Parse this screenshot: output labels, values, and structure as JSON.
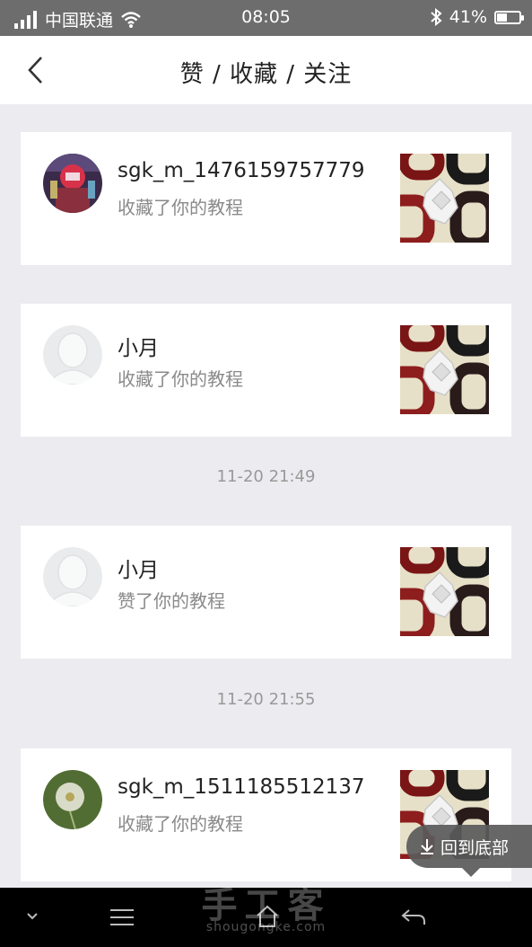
{
  "status": {
    "carrier": "中国联通",
    "time": "08:05",
    "battery": "41%",
    "battery_level": 0.41
  },
  "header": {
    "title": "赞 / 收藏 / 关注"
  },
  "notifications": [
    {
      "name": "sgk_m_1476159757779",
      "action": "收藏了你的教程",
      "avatar": "photo-avatar"
    },
    {
      "name": "小月",
      "action": "收藏了你的教程",
      "avatar": "default-avatar"
    },
    {
      "name": "小月",
      "action": "赞了你的教程",
      "avatar": "default-avatar"
    },
    {
      "name": "sgk_m_1511185512137",
      "action": "收藏了你的教程",
      "avatar": "dandelion-avatar"
    }
  ],
  "timestamps": [
    "11-20 21:49",
    "11-20 21:55"
  ],
  "scroll_button": {
    "label": "回到底部"
  },
  "watermark": {
    "text": "手工客",
    "url": "shougongke.com"
  },
  "colors": {
    "statusbar": "#6d6d6d",
    "background": "#ececf0",
    "card": "#ffffff",
    "muted_text": "#8a8a8a"
  }
}
